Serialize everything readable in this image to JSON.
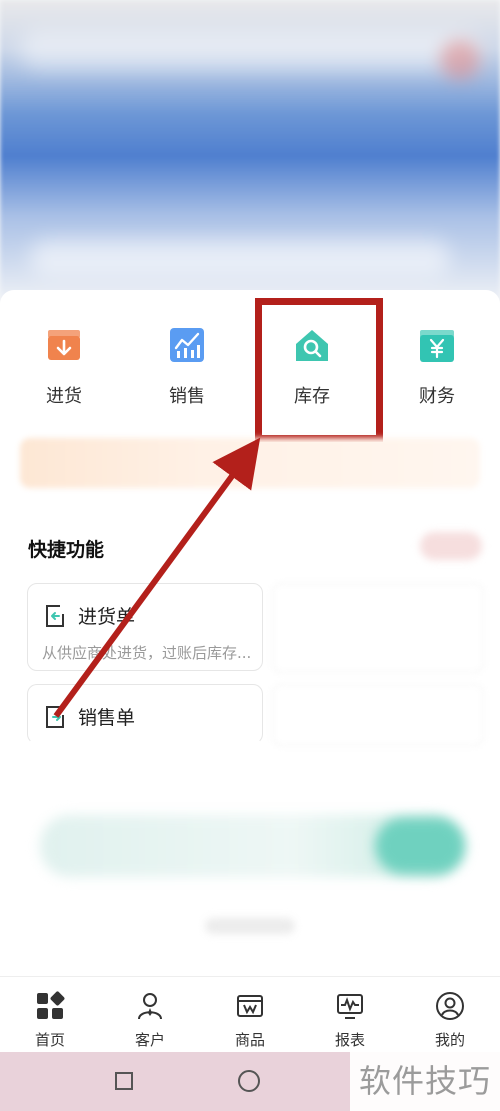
{
  "quick_actions": [
    {
      "label": "进货",
      "icon": "purchase-box-icon",
      "color": "#f0834d"
    },
    {
      "label": "销售",
      "icon": "sales-chart-icon",
      "color": "#5a9cf2"
    },
    {
      "label": "库存",
      "icon": "inventory-house-icon",
      "color": "#3ec6b0"
    },
    {
      "label": "财务",
      "icon": "finance-yen-icon",
      "color": "#32c4b3"
    }
  ],
  "shortcuts": {
    "title": "快捷功能",
    "items": [
      {
        "title": "进货单",
        "desc": "从供应商处进货，过账后库存..."
      },
      {
        "title": "销售单",
        "desc": ""
      }
    ]
  },
  "tabbar": [
    {
      "label": "首页",
      "icon": "home-grid-icon"
    },
    {
      "label": "客户",
      "icon": "customer-icon"
    },
    {
      "label": "商品",
      "icon": "product-icon"
    },
    {
      "label": "报表",
      "icon": "report-icon"
    },
    {
      "label": "我的",
      "icon": "profile-icon"
    }
  ],
  "watermark": "软件技巧",
  "colors": {
    "highlight": "#b3201b",
    "accent": "#3ec6b0"
  }
}
